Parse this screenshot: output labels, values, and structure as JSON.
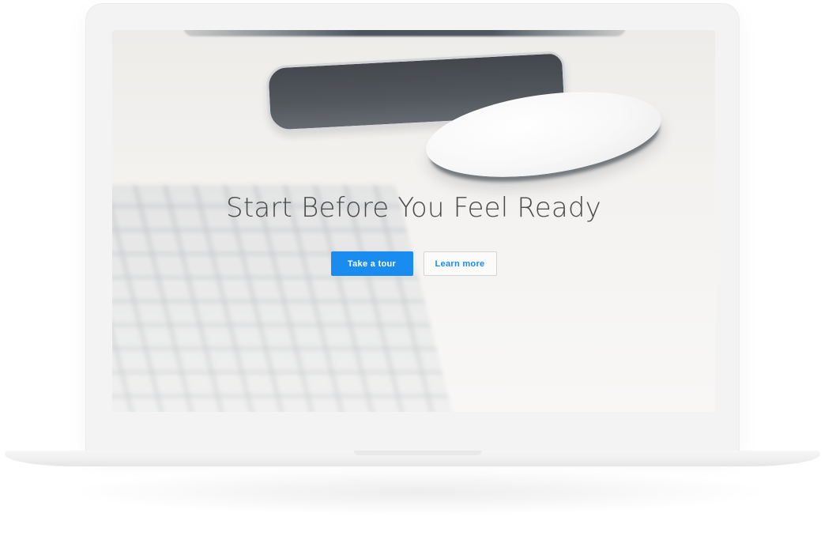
{
  "hero": {
    "title": "Start Before You Feel Ready",
    "primary_button": "Take a tour",
    "secondary_button": "Learn more"
  },
  "colors": {
    "accent": "#1a8cf0",
    "title_text": "#4a4a4a",
    "laptop_body": "#f3f3f3"
  },
  "background_photo": {
    "depicts": [
      "smartphone-icon",
      "mouse-icon",
      "keyboard-icon"
    ]
  }
}
